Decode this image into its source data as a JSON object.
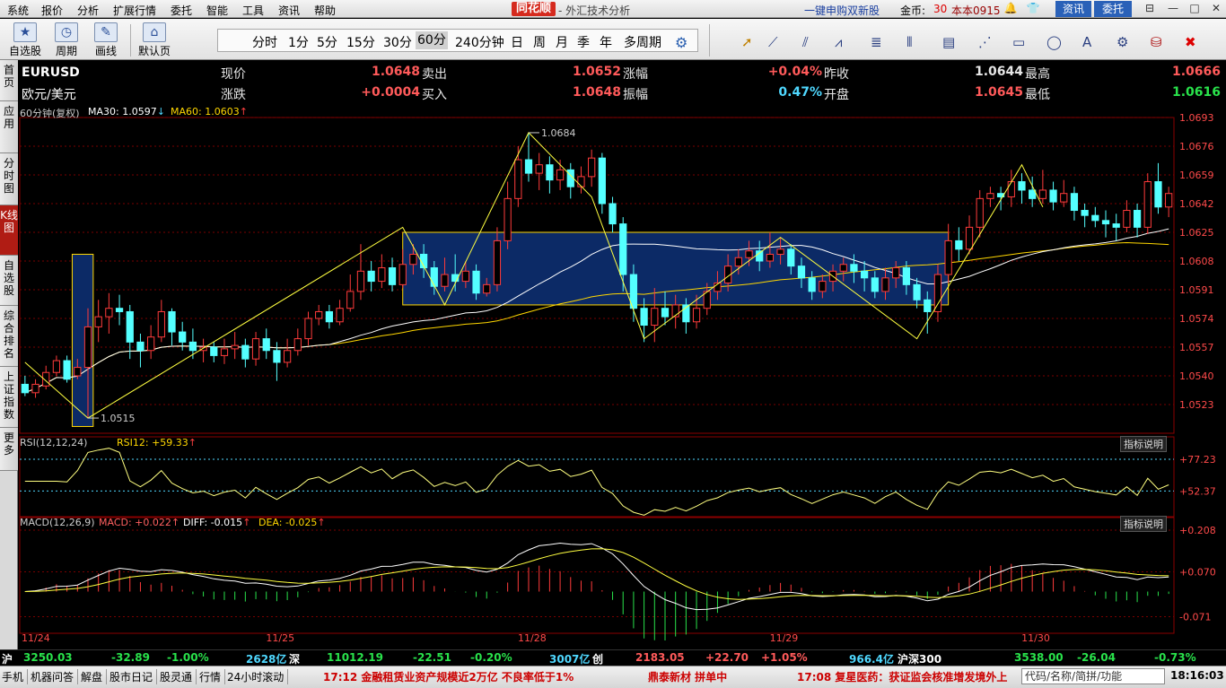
{
  "menu": {
    "items": [
      "系统",
      "报价",
      "分析",
      "扩展行情",
      "委托",
      "智能",
      "工具",
      "资讯",
      "帮助"
    ],
    "brand": "同花顺",
    "brand_sub": "- 外汇技术分析",
    "promo": "一键申购双新股",
    "coin_label": "金币:",
    "coin_value": "30",
    "version": "本本0915",
    "news_btn": "资讯",
    "trade_btn": "委托",
    "win_min": "—",
    "win_max": "□",
    "win_close": "✕"
  },
  "toolbar": {
    "self_select": "自选股",
    "period": "周期",
    "draw": "画线",
    "default_page": "默认页",
    "periods": [
      "分时",
      "1分",
      "5分",
      "15分",
      "30分",
      "60分",
      "240分钟",
      "日",
      "周",
      "月",
      "季",
      "年",
      "多周期"
    ],
    "selected_period": "60分"
  },
  "left_tabs": [
    "首页",
    "应用",
    "分时图",
    "K线图",
    "自选股",
    "综合排名",
    "上证指数",
    "更多"
  ],
  "quote": {
    "symbol": "EURUSD",
    "name": "欧元/美元",
    "rows": [
      [
        {
          "label": "现价",
          "value": "1.0648"
        },
        {
          "label": "卖出",
          "value": "1.0652"
        },
        {
          "label": "涨幅",
          "value": "+0.04%"
        },
        {
          "label": "昨收",
          "value": "1.0644"
        },
        {
          "label": "最高",
          "value": "1.0666"
        }
      ],
      [
        {
          "label": "涨跌",
          "value": "+0.0004"
        },
        {
          "label": "买入",
          "value": "1.0648"
        },
        {
          "label": "振幅",
          "value": "0.47%"
        },
        {
          "label": "开盘",
          "value": "1.0645"
        },
        {
          "label": "最低",
          "value": "1.0616"
        }
      ]
    ]
  },
  "indicators": {
    "main": {
      "title": "60分钟(复权)",
      "ma30": "MA30: 1.0597",
      "ma60": "MA60: 1.0603"
    },
    "rsi": {
      "title": "RSI(12,12,24)",
      "value": "RSI12: +59.33"
    },
    "macd": {
      "title": "MACD(12,26,9)",
      "macd": "MACD: +0.022",
      "diff": "DIFF: -0.015",
      "dea": "DEA: -0.025"
    },
    "explain": "指标说明"
  },
  "chart_data": {
    "type": "candlestick",
    "ylim": [
      1.0506,
      1.0693
    ],
    "y_ticks": [
      "1.0693",
      "1.0676",
      "1.0659",
      "1.0642",
      "1.0625",
      "1.0608",
      "1.0591",
      "1.0574",
      "1.0557",
      "1.0540",
      "1.0523"
    ],
    "x_labels": [
      "11/24",
      "11/25",
      "11/28",
      "11/29",
      "11/30"
    ],
    "x_label_index": [
      0,
      24,
      48,
      72,
      96
    ],
    "annotations": {
      "high": "1.0684",
      "low": "1.0515",
      "high_index": 48,
      "low_index": 6
    },
    "box": {
      "i0": 36,
      "i1": 88,
      "y0": 1.0625,
      "y1": 1.0582
    },
    "tall_box": {
      "i0": 5,
      "i1": 7,
      "y0": 1.0612,
      "y1": 1.051
    },
    "candles": [
      [
        1.0535,
        1.053,
        1.054,
        1.0528
      ],
      [
        1.053,
        1.0535,
        1.0538,
        1.0527
      ],
      [
        1.0534,
        1.0542,
        1.0546,
        1.0532
      ],
      [
        1.0542,
        1.0549,
        1.0552,
        1.054
      ],
      [
        1.0549,
        1.0538,
        1.0552,
        1.0536
      ],
      [
        1.054,
        1.0545,
        1.055,
        1.0538
      ],
      [
        1.0545,
        1.0569,
        1.058,
        1.0515
      ],
      [
        1.0569,
        1.0575,
        1.0585,
        1.056
      ],
      [
        1.0575,
        1.058,
        1.0589,
        1.0565
      ],
      [
        1.058,
        1.0578,
        1.0588,
        1.057
      ],
      [
        1.0578,
        1.056,
        1.0582,
        1.055
      ],
      [
        1.056,
        1.0555,
        1.0565,
        1.0545
      ],
      [
        1.0555,
        1.0563,
        1.057,
        1.055
      ],
      [
        1.0563,
        1.0578,
        1.0585,
        1.056
      ],
      [
        1.0578,
        1.0566,
        1.058,
        1.0558
      ],
      [
        1.0566,
        1.056,
        1.0572,
        1.0555
      ],
      [
        1.056,
        1.0555,
        1.0568,
        1.055
      ],
      [
        1.0555,
        1.0557,
        1.0562,
        1.0548
      ],
      [
        1.0557,
        1.0552,
        1.056,
        1.0548
      ],
      [
        1.0552,
        1.0556,
        1.0562,
        1.0547
      ],
      [
        1.0556,
        1.0558,
        1.0566,
        1.055
      ],
      [
        1.0558,
        1.055,
        1.0562,
        1.0545
      ],
      [
        1.055,
        1.0562,
        1.0566,
        1.0546
      ],
      [
        1.0562,
        1.0555,
        1.0568,
        1.055
      ],
      [
        1.0555,
        1.0548,
        1.056,
        1.0537
      ],
      [
        1.0548,
        1.0555,
        1.0562,
        1.0545
      ],
      [
        1.0555,
        1.0562,
        1.0568,
        1.0552
      ],
      [
        1.0562,
        1.0574,
        1.0578,
        1.0558
      ],
      [
        1.0574,
        1.0578,
        1.0582,
        1.057
      ],
      [
        1.0578,
        1.0572,
        1.0582,
        1.0568
      ],
      [
        1.0572,
        1.058,
        1.0585,
        1.057
      ],
      [
        1.058,
        1.059,
        1.06,
        1.0578
      ],
      [
        1.059,
        1.0602,
        1.0618,
        1.0585
      ],
      [
        1.0602,
        1.0596,
        1.0608,
        1.059
      ],
      [
        1.0596,
        1.0604,
        1.0612,
        1.0592
      ],
      [
        1.0604,
        1.0594,
        1.061,
        1.059
      ],
      [
        1.0594,
        1.0606,
        1.0615,
        1.0592
      ],
      [
        1.0606,
        1.0612,
        1.0618,
        1.06
      ],
      [
        1.0612,
        1.0604,
        1.0618,
        1.0598
      ],
      [
        1.0604,
        1.0593,
        1.0608,
        1.0588
      ],
      [
        1.0593,
        1.06,
        1.061,
        1.059
      ],
      [
        1.06,
        1.0596,
        1.0612,
        1.059
      ],
      [
        1.0596,
        1.0602,
        1.0608,
        1.0592
      ],
      [
        1.0602,
        1.0589,
        1.0606,
        1.0585
      ],
      [
        1.0589,
        1.0594,
        1.0598,
        1.0587
      ],
      [
        1.0594,
        1.062,
        1.0628,
        1.059
      ],
      [
        1.062,
        1.0645,
        1.0655,
        1.0615
      ],
      [
        1.0645,
        1.0668,
        1.0676,
        1.064
      ],
      [
        1.0668,
        1.066,
        1.0684,
        1.0655
      ],
      [
        1.066,
        1.0665,
        1.0672,
        1.065
      ],
      [
        1.0665,
        1.0656,
        1.067,
        1.0648
      ],
      [
        1.0656,
        1.0662,
        1.0668,
        1.065
      ],
      [
        1.0662,
        1.0652,
        1.0666,
        1.0645
      ],
      [
        1.0652,
        1.0658,
        1.0664,
        1.0648
      ],
      [
        1.0658,
        1.0669,
        1.0674,
        1.0652
      ],
      [
        1.0669,
        1.0642,
        1.0672,
        1.0636
      ],
      [
        1.0642,
        1.063,
        1.0646,
        1.0625
      ],
      [
        1.063,
        1.06,
        1.0634,
        1.059
      ],
      [
        1.06,
        1.058,
        1.0606,
        1.0572
      ],
      [
        1.058,
        1.057,
        1.0586,
        1.056
      ],
      [
        1.057,
        1.058,
        1.0592,
        1.056
      ],
      [
        1.058,
        1.0575,
        1.059,
        1.057
      ],
      [
        1.0575,
        1.0582,
        1.0588,
        1.0568
      ],
      [
        1.0582,
        1.0572,
        1.0586,
        1.0565
      ],
      [
        1.0572,
        1.058,
        1.0588,
        1.0568
      ],
      [
        1.058,
        1.059,
        1.0595,
        1.0576
      ],
      [
        1.059,
        1.0595,
        1.0602,
        1.0585
      ],
      [
        1.0595,
        1.0605,
        1.0612,
        1.059
      ],
      [
        1.0605,
        1.061,
        1.0615,
        1.06
      ],
      [
        1.061,
        1.0614,
        1.062,
        1.0605
      ],
      [
        1.0614,
        1.0608,
        1.062,
        1.0602
      ],
      [
        1.0608,
        1.0612,
        1.0625,
        1.0604
      ],
      [
        1.0612,
        1.0615,
        1.0622,
        1.0606
      ],
      [
        1.0615,
        1.0605,
        1.0618,
        1.06
      ],
      [
        1.0605,
        1.0598,
        1.061,
        1.0592
      ],
      [
        1.0598,
        1.059,
        1.0602,
        1.0585
      ],
      [
        1.059,
        1.0596,
        1.06,
        1.0586
      ],
      [
        1.0596,
        1.0602,
        1.0606,
        1.059
      ],
      [
        1.0602,
        1.0606,
        1.061,
        1.0596
      ],
      [
        1.0606,
        1.0602,
        1.0612,
        1.0595
      ],
      [
        1.0602,
        1.0598,
        1.0608,
        1.059
      ],
      [
        1.0598,
        1.059,
        1.0602,
        1.0586
      ],
      [
        1.059,
        1.0598,
        1.0604,
        1.0585
      ],
      [
        1.0598,
        1.0604,
        1.0608,
        1.0592
      ],
      [
        1.0604,
        1.0594,
        1.0608,
        1.0588
      ],
      [
        1.0594,
        1.0585,
        1.0598,
        1.058
      ],
      [
        1.0585,
        1.0578,
        1.059,
        1.0565
      ],
      [
        1.0578,
        1.06,
        1.0606,
        1.0572
      ],
      [
        1.06,
        1.062,
        1.063,
        1.0595
      ],
      [
        1.062,
        1.0615,
        1.0628,
        1.0608
      ],
      [
        1.0615,
        1.0628,
        1.0635,
        1.0612
      ],
      [
        1.0628,
        1.0645,
        1.065,
        1.0622
      ],
      [
        1.0645,
        1.0648,
        1.0652,
        1.064
      ],
      [
        1.0648,
        1.0646,
        1.0652,
        1.0638
      ],
      [
        1.0646,
        1.0655,
        1.0662,
        1.064
      ],
      [
        1.0655,
        1.065,
        1.066,
        1.0642
      ],
      [
        1.065,
        1.0645,
        1.0658,
        1.064
      ],
      [
        1.0645,
        1.065,
        1.0662,
        1.0642
      ],
      [
        1.065,
        1.0643,
        1.0655,
        1.0638
      ],
      [
        1.0643,
        1.0648,
        1.0656,
        1.064
      ],
      [
        1.0648,
        1.0638,
        1.0652,
        1.0632
      ],
      [
        1.0638,
        1.0635,
        1.0642,
        1.0628
      ],
      [
        1.0635,
        1.0632,
        1.064,
        1.0628
      ],
      [
        1.0632,
        1.063,
        1.0638,
        1.0622
      ],
      [
        1.063,
        1.0628,
        1.0636,
        1.062
      ],
      [
        1.0628,
        1.0638,
        1.0644,
        1.0625
      ],
      [
        1.0638,
        1.0628,
        1.0642,
        1.0622
      ],
      [
        1.0628,
        1.0655,
        1.066,
        1.0624
      ],
      [
        1.0655,
        1.064,
        1.0666,
        1.0636
      ],
      [
        1.064,
        1.0648,
        1.0652,
        1.0634
      ]
    ]
  },
  "status": {
    "sh_label": "沪",
    "sh_index": "3250.03",
    "sh_chg": "-32.89",
    "sh_pct": "-1.00%",
    "sh_amt": "2628亿",
    "sz_label": "深",
    "sz_index": "11012.19",
    "sz_chg": "-22.51",
    "sz_pct": "-0.20%",
    "sz_amt": "3007亿",
    "cy_label": "创",
    "cy_index": "2183.05",
    "cy_chg": "+22.70",
    "cy_pct": "+1.05%",
    "cy_amt": "966.4亿",
    "hs_label": "沪深300",
    "hs_index": "3538.00",
    "hs_chg": "-26.04",
    "hs_pct": "-0.73%"
  },
  "newsbar": {
    "tabs": [
      "手机",
      "机器问答",
      "解盘",
      "股市日记",
      "股灵通",
      "行情",
      "24小时滚动"
    ],
    "news1": "17:12 金融租赁业资产规模近2万亿 不良率低于1%",
    "news2": "鼎泰新材 拼单中",
    "news3": "17:08 复星医药：获证监会核准增发境外上",
    "search_placeholder": "代码/名称/简拼/功能",
    "clock": "18:16:03"
  }
}
